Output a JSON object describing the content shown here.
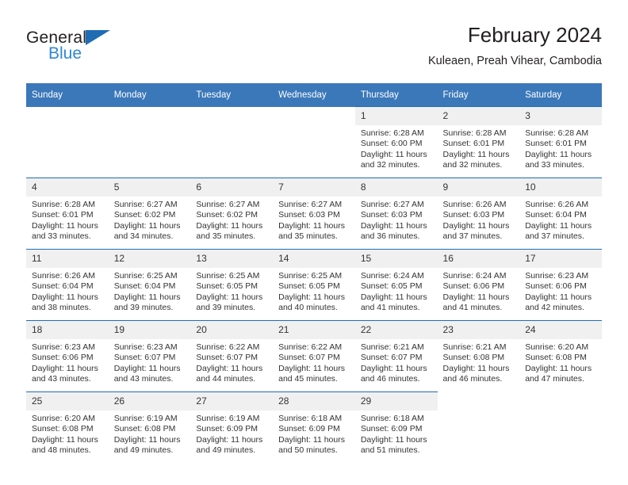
{
  "brand": {
    "name_part1": "General",
    "name_part2": "Blue",
    "triangle_color": "#1f6cb4",
    "blue_color": "#2f87d6"
  },
  "header": {
    "title": "February 2024",
    "subtitle": "Kuleaen, Preah Vihear, Cambodia"
  },
  "theme": {
    "header_bg": "#3b78b9",
    "row_rule": "#1f6cb4",
    "day_band": "#f0f0f0"
  },
  "calendar": {
    "weekdays": [
      "Sunday",
      "Monday",
      "Tuesday",
      "Wednesday",
      "Thursday",
      "Friday",
      "Saturday"
    ],
    "weeks": [
      [
        {
          "blank": true
        },
        {
          "blank": true
        },
        {
          "blank": true
        },
        {
          "blank": true
        },
        {
          "day": "1",
          "sunrise": "Sunrise: 6:28 AM",
          "sunset": "Sunset: 6:00 PM",
          "daylight1": "Daylight: 11 hours",
          "daylight2": "and 32 minutes."
        },
        {
          "day": "2",
          "sunrise": "Sunrise: 6:28 AM",
          "sunset": "Sunset: 6:01 PM",
          "daylight1": "Daylight: 11 hours",
          "daylight2": "and 32 minutes."
        },
        {
          "day": "3",
          "sunrise": "Sunrise: 6:28 AM",
          "sunset": "Sunset: 6:01 PM",
          "daylight1": "Daylight: 11 hours",
          "daylight2": "and 33 minutes."
        }
      ],
      [
        {
          "day": "4",
          "sunrise": "Sunrise: 6:28 AM",
          "sunset": "Sunset: 6:01 PM",
          "daylight1": "Daylight: 11 hours",
          "daylight2": "and 33 minutes."
        },
        {
          "day": "5",
          "sunrise": "Sunrise: 6:27 AM",
          "sunset": "Sunset: 6:02 PM",
          "daylight1": "Daylight: 11 hours",
          "daylight2": "and 34 minutes."
        },
        {
          "day": "6",
          "sunrise": "Sunrise: 6:27 AM",
          "sunset": "Sunset: 6:02 PM",
          "daylight1": "Daylight: 11 hours",
          "daylight2": "and 35 minutes."
        },
        {
          "day": "7",
          "sunrise": "Sunrise: 6:27 AM",
          "sunset": "Sunset: 6:03 PM",
          "daylight1": "Daylight: 11 hours",
          "daylight2": "and 35 minutes."
        },
        {
          "day": "8",
          "sunrise": "Sunrise: 6:27 AM",
          "sunset": "Sunset: 6:03 PM",
          "daylight1": "Daylight: 11 hours",
          "daylight2": "and 36 minutes."
        },
        {
          "day": "9",
          "sunrise": "Sunrise: 6:26 AM",
          "sunset": "Sunset: 6:03 PM",
          "daylight1": "Daylight: 11 hours",
          "daylight2": "and 37 minutes."
        },
        {
          "day": "10",
          "sunrise": "Sunrise: 6:26 AM",
          "sunset": "Sunset: 6:04 PM",
          "daylight1": "Daylight: 11 hours",
          "daylight2": "and 37 minutes."
        }
      ],
      [
        {
          "day": "11",
          "sunrise": "Sunrise: 6:26 AM",
          "sunset": "Sunset: 6:04 PM",
          "daylight1": "Daylight: 11 hours",
          "daylight2": "and 38 minutes."
        },
        {
          "day": "12",
          "sunrise": "Sunrise: 6:25 AM",
          "sunset": "Sunset: 6:04 PM",
          "daylight1": "Daylight: 11 hours",
          "daylight2": "and 39 minutes."
        },
        {
          "day": "13",
          "sunrise": "Sunrise: 6:25 AM",
          "sunset": "Sunset: 6:05 PM",
          "daylight1": "Daylight: 11 hours",
          "daylight2": "and 39 minutes."
        },
        {
          "day": "14",
          "sunrise": "Sunrise: 6:25 AM",
          "sunset": "Sunset: 6:05 PM",
          "daylight1": "Daylight: 11 hours",
          "daylight2": "and 40 minutes."
        },
        {
          "day": "15",
          "sunrise": "Sunrise: 6:24 AM",
          "sunset": "Sunset: 6:05 PM",
          "daylight1": "Daylight: 11 hours",
          "daylight2": "and 41 minutes."
        },
        {
          "day": "16",
          "sunrise": "Sunrise: 6:24 AM",
          "sunset": "Sunset: 6:06 PM",
          "daylight1": "Daylight: 11 hours",
          "daylight2": "and 41 minutes."
        },
        {
          "day": "17",
          "sunrise": "Sunrise: 6:23 AM",
          "sunset": "Sunset: 6:06 PM",
          "daylight1": "Daylight: 11 hours",
          "daylight2": "and 42 minutes."
        }
      ],
      [
        {
          "day": "18",
          "sunrise": "Sunrise: 6:23 AM",
          "sunset": "Sunset: 6:06 PM",
          "daylight1": "Daylight: 11 hours",
          "daylight2": "and 43 minutes."
        },
        {
          "day": "19",
          "sunrise": "Sunrise: 6:23 AM",
          "sunset": "Sunset: 6:07 PM",
          "daylight1": "Daylight: 11 hours",
          "daylight2": "and 43 minutes."
        },
        {
          "day": "20",
          "sunrise": "Sunrise: 6:22 AM",
          "sunset": "Sunset: 6:07 PM",
          "daylight1": "Daylight: 11 hours",
          "daylight2": "and 44 minutes."
        },
        {
          "day": "21",
          "sunrise": "Sunrise: 6:22 AM",
          "sunset": "Sunset: 6:07 PM",
          "daylight1": "Daylight: 11 hours",
          "daylight2": "and 45 minutes."
        },
        {
          "day": "22",
          "sunrise": "Sunrise: 6:21 AM",
          "sunset": "Sunset: 6:07 PM",
          "daylight1": "Daylight: 11 hours",
          "daylight2": "and 46 minutes."
        },
        {
          "day": "23",
          "sunrise": "Sunrise: 6:21 AM",
          "sunset": "Sunset: 6:08 PM",
          "daylight1": "Daylight: 11 hours",
          "daylight2": "and 46 minutes."
        },
        {
          "day": "24",
          "sunrise": "Sunrise: 6:20 AM",
          "sunset": "Sunset: 6:08 PM",
          "daylight1": "Daylight: 11 hours",
          "daylight2": "and 47 minutes."
        }
      ],
      [
        {
          "day": "25",
          "sunrise": "Sunrise: 6:20 AM",
          "sunset": "Sunset: 6:08 PM",
          "daylight1": "Daylight: 11 hours",
          "daylight2": "and 48 minutes."
        },
        {
          "day": "26",
          "sunrise": "Sunrise: 6:19 AM",
          "sunset": "Sunset: 6:08 PM",
          "daylight1": "Daylight: 11 hours",
          "daylight2": "and 49 minutes."
        },
        {
          "day": "27",
          "sunrise": "Sunrise: 6:19 AM",
          "sunset": "Sunset: 6:09 PM",
          "daylight1": "Daylight: 11 hours",
          "daylight2": "and 49 minutes."
        },
        {
          "day": "28",
          "sunrise": "Sunrise: 6:18 AM",
          "sunset": "Sunset: 6:09 PM",
          "daylight1": "Daylight: 11 hours",
          "daylight2": "and 50 minutes."
        },
        {
          "day": "29",
          "sunrise": "Sunrise: 6:18 AM",
          "sunset": "Sunset: 6:09 PM",
          "daylight1": "Daylight: 11 hours",
          "daylight2": "and 51 minutes."
        },
        {
          "blank": true
        },
        {
          "blank": true
        }
      ]
    ]
  }
}
